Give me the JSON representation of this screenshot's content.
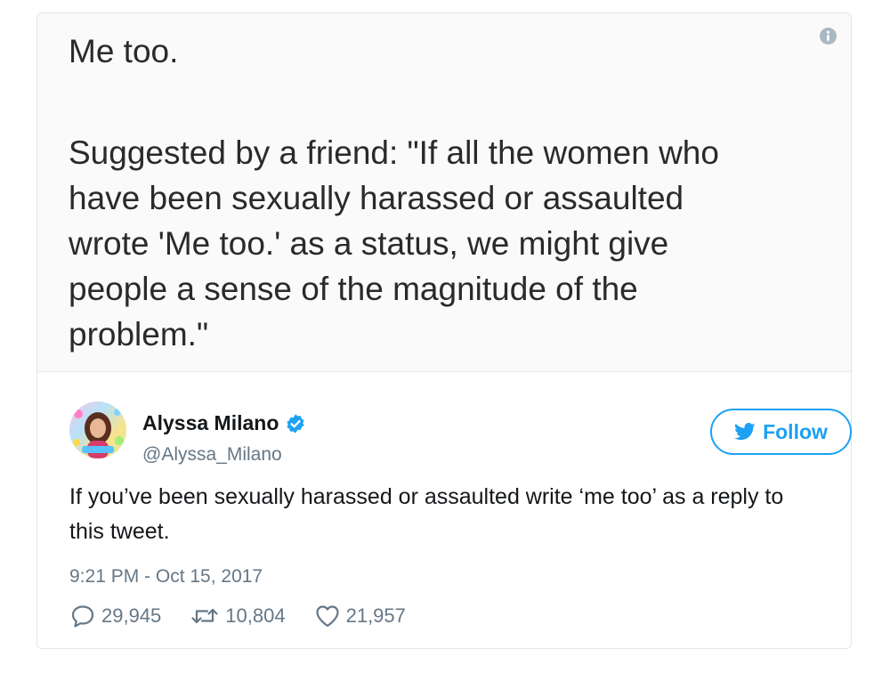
{
  "screenshot": {
    "line1": "Me too.",
    "paragraph": "Suggested by a friend: \"If all the women who\nhave been sexually harassed or assaulted\nwrote 'Me too.' as a status, we might give\npeople a sense of the magnitude of the\nproblem.\""
  },
  "author": {
    "display_name": "Alyssa Milano",
    "handle": "@Alyssa_Milano",
    "verified_icon": "verified-badge-icon",
    "avatar_icon": "avatar"
  },
  "follow_button": {
    "label": "Follow",
    "icon": "twitter-bird-icon"
  },
  "tweet": {
    "text": "If you’ve been sexually harassed or assaulted write ‘me too’ as a reply to this tweet.",
    "timestamp": "9:21 PM - Oct 15, 2017"
  },
  "actions": {
    "replies": "29,945",
    "retweets": "10,804",
    "likes": "21,957"
  },
  "colors": {
    "accent": "#1da1f2",
    "muted": "#657786",
    "border": "#e1e8ed"
  }
}
